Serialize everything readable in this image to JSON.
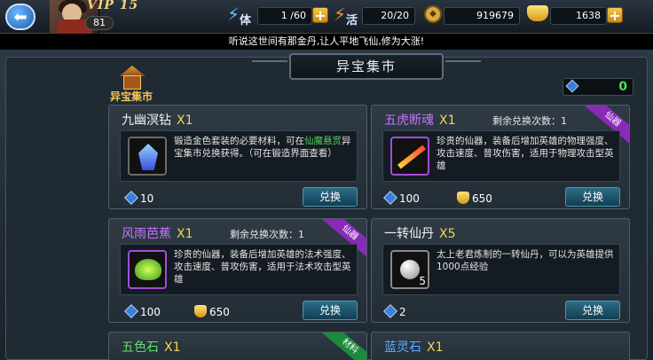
{
  "topbar": {
    "vip": "VIP 15",
    "level": "81",
    "stamina_label": "体",
    "stamina_value": "1 /60",
    "vitality_label": "活",
    "vitality_value": "20/20",
    "coins": "919679",
    "ingots": "1638"
  },
  "notice": "听说这世间有那金丹,让人平地飞仙,修为大涨!",
  "panel": {
    "title": "异宝集市",
    "market_label": "异宝集市",
    "currency": "0"
  },
  "cards": [
    {
      "name": "九幽溟钻",
      "qty": "X1",
      "remaining": "",
      "desc_pre": "锻造金色套装的必要材料，可在",
      "desc_highlight": "仙魔悬赏",
      "desc_post": "异宝集市兑换获得。（可在锻造界面查看）",
      "cost_gem": "10",
      "cost_gold": "",
      "button": "兑换",
      "ribbon": ""
    },
    {
      "name": "五虎断魂",
      "qty": "X1",
      "remaining": "剩余兑换次数：1",
      "desc_pre": "珍贵的仙器，装备后增加英雄的物理强度、攻击速度、普攻伤害，适用于物理攻击型英雄",
      "desc_highlight": "",
      "desc_post": "",
      "cost_gem": "100",
      "cost_gold": "650",
      "button": "兑换",
      "ribbon": "仙器"
    },
    {
      "name": "风雨芭蕉",
      "qty": "X1",
      "remaining": "剩余兑换次数：1",
      "desc_pre": "珍贵的仙器，装备后增加英雄的法术强度、攻击速度、普攻伤害，适用于法术攻击型英雄",
      "desc_highlight": "",
      "desc_post": "",
      "cost_gem": "100",
      "cost_gold": "650",
      "button": "兑换",
      "ribbon": "仙器"
    },
    {
      "name": "一转仙丹",
      "qty": "X5",
      "remaining": "",
      "desc_pre": "太上老君炼制的一转仙丹，可以为英雄提供1000点经验",
      "desc_highlight": "",
      "desc_post": "",
      "cost_gem": "2",
      "cost_gold": "",
      "button": "兑换",
      "ribbon": "",
      "item_count": "5"
    },
    {
      "name": "五色石",
      "qty": "X1",
      "ribbon": "材料"
    },
    {
      "name": "蓝灵石",
      "qty": "X1"
    }
  ]
}
